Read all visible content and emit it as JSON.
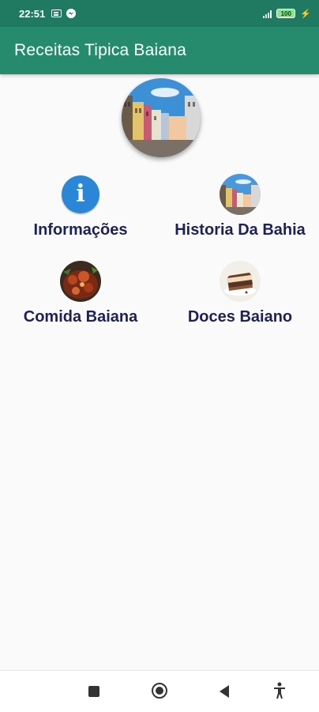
{
  "status_bar": {
    "time": "22:51",
    "battery": "100"
  },
  "app_bar": {
    "title": "Receitas Tipica Baiana"
  },
  "tiles": [
    {
      "label": "Informações",
      "icon": "info-icon"
    },
    {
      "label": "Historia Da Bahia",
      "icon": "bahia-street-image"
    },
    {
      "label": "Comida Baiana",
      "icon": "comida-image"
    },
    {
      "label": "Doces Baiano",
      "icon": "cake-image"
    }
  ],
  "colors": {
    "status_bar": "#1f7a61",
    "app_bar": "#258b6c",
    "label_text": "#1c2257",
    "info_icon": "#2a86d6"
  }
}
